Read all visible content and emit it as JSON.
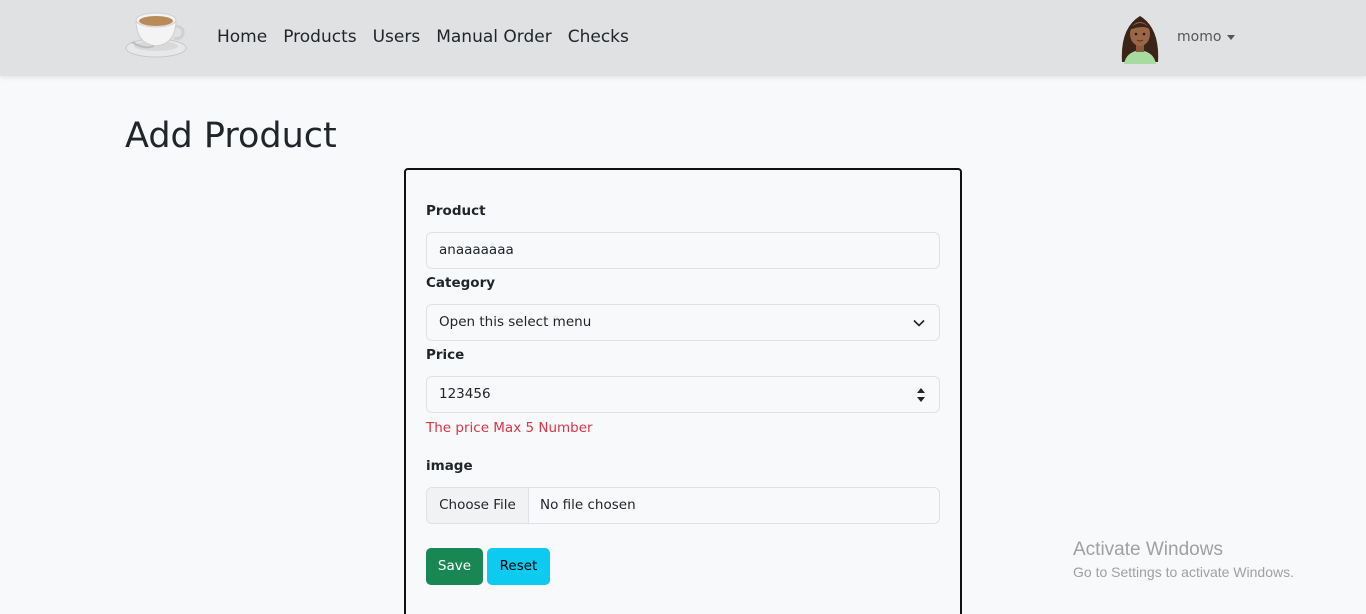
{
  "navbar": {
    "logo_icon": "coffee-cup-icon",
    "links": [
      "Home",
      "Products",
      "Users",
      "Manual Order",
      "Checks"
    ],
    "user": {
      "name": "momo",
      "avatar_icon": "user-avatar"
    }
  },
  "page": {
    "title": "Add Product"
  },
  "form": {
    "product": {
      "label": "Product",
      "value": "anaaaaaaa"
    },
    "category": {
      "label": "Category",
      "selected": "Open this select menu"
    },
    "price": {
      "label": "Price",
      "value": "123456",
      "error": "The price Max 5 Number"
    },
    "image": {
      "label": "image",
      "button": "Choose File",
      "status": "No file chosen"
    },
    "save_label": "Save",
    "reset_label": "Reset"
  },
  "watermark": {
    "title": "Activate Windows",
    "subtitle": "Go to Settings to activate Windows."
  },
  "colors": {
    "save": "#198754",
    "reset": "#0dcaf0",
    "error": "#dc3545",
    "navbar": "#e0e1e3"
  }
}
